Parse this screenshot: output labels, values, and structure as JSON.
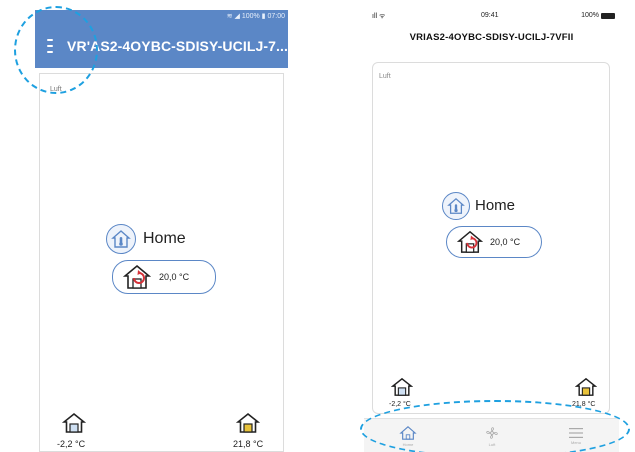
{
  "android": {
    "status_text": "≋ ◢ 100% ▮ 07:00",
    "title": "VR'AS2-4OYBC-SDISY-UCILJ-7...",
    "panel_label": "Luft",
    "home_label": "Home",
    "setpoint": "20,0 °C",
    "outdoor_temp": "-2,2 °C",
    "indoor_temp": "21,8 °C"
  },
  "ios": {
    "signal": "ıll ᯤ",
    "time": "09:41",
    "battery": "100%",
    "title": "VRIAS2-4OYBC-SDISY-UCILJ-7VFII",
    "panel_label": "Luft",
    "home_label": "Home",
    "setpoint": "20,0 °C",
    "outdoor_temp": "-2,2 °C",
    "indoor_temp": "21,8 °C",
    "tabs": [
      "Home",
      "Luft",
      "Menu"
    ]
  },
  "colors": {
    "brand_blue": "#5b87c6",
    "highlight": "#1ea0e0",
    "heat_red": "#d6333a",
    "warm_yellow": "#e8c23a"
  }
}
